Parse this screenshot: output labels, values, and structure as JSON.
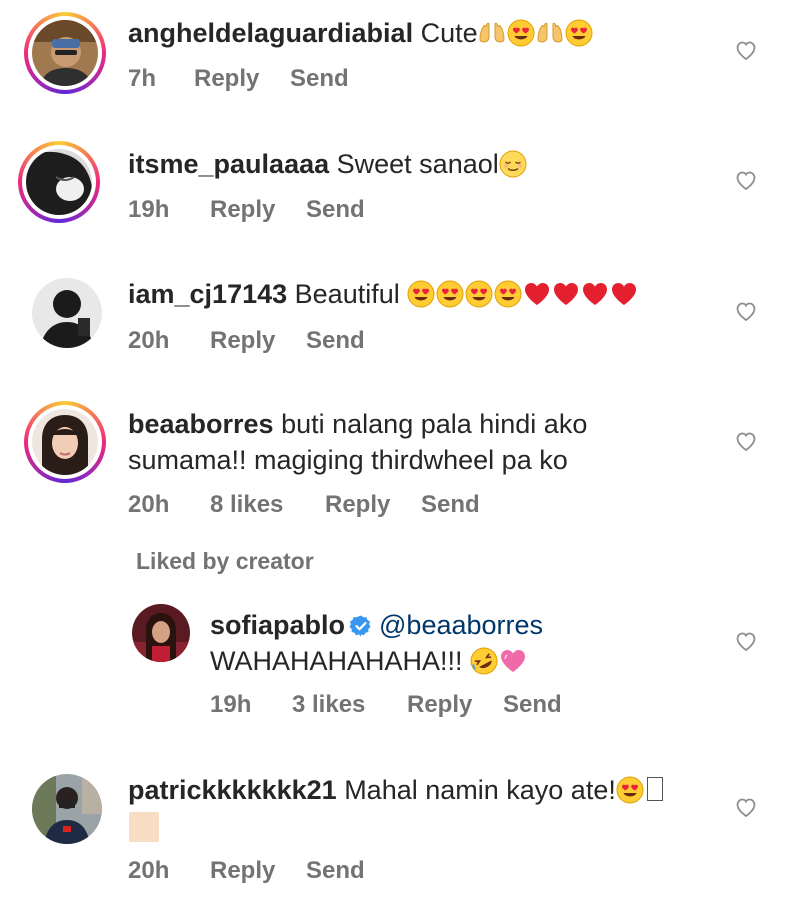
{
  "comments": [
    {
      "username": "angheldelaguardiabial",
      "text": "Cute",
      "emojis": [
        "raised-hands",
        "heart-eyes",
        "raised-hands",
        "heart-eyes"
      ],
      "time": "7h",
      "likes": "",
      "reply": "Reply",
      "send": "Send",
      "story_ring": true
    },
    {
      "username": "itsme_paulaaaa",
      "text": "Sweet sanaol",
      "emojis": [
        "relieved"
      ],
      "time": "19h",
      "likes": "",
      "reply": "Reply",
      "send": "Send",
      "story_ring": true
    },
    {
      "username": "iam_cj17143",
      "text": "Beautiful",
      "emojis": [
        "heart-eyes",
        "heart-eyes",
        "heart-eyes",
        "heart-eyes",
        "red-heart",
        "red-heart",
        "red-heart",
        "red-heart"
      ],
      "time": "20h",
      "likes": "",
      "reply": "Reply",
      "send": "Send",
      "story_ring": false
    },
    {
      "username": "beaaborres",
      "text_line1": "buti nalang pala hindi ako",
      "text_line2": "sumama!! magiging thirdwheel pa ko",
      "time": "20h",
      "likes": "8 likes",
      "reply": "Reply",
      "send": "Send",
      "story_ring": true
    },
    {
      "username": "patrickkkkkkk21",
      "text": "Mahal namin kayo ate!",
      "emojis": [
        "heart-eyes"
      ],
      "time": "20h",
      "likes": "",
      "reply": "Reply",
      "send": "Send",
      "story_ring": false
    }
  ],
  "liked_by_creator": "Liked by creator",
  "reply": {
    "username": "sofiapablo",
    "verified": true,
    "mention": "@beaaborres",
    "text": "WAHAHAHAHAHA!!!",
    "emojis": [
      "rofl",
      "pink-heart"
    ],
    "time": "19h",
    "likes": "3 likes",
    "reply": "Reply",
    "send": "Send"
  },
  "colors": {
    "text": "#262626",
    "meta": "#737373",
    "mention": "#00376b",
    "verified": "#3897f0"
  }
}
